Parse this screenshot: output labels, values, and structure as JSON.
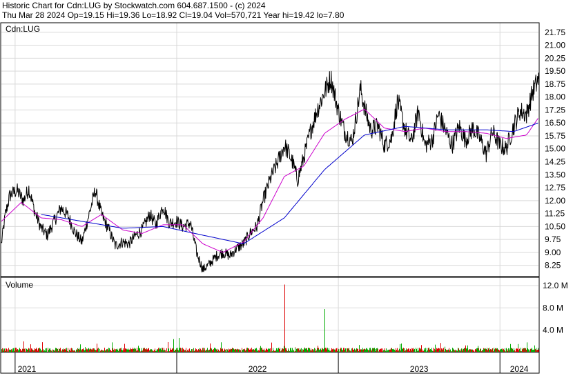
{
  "header": {
    "line1": "Historic Chart for Cdn:LUG by Stockwatch.com 604.687.1500 - (c) 2024",
    "line2": "Thu Mar 28 2024   Op=19.15  Hi=19.36  Lo=18.92  Cl=19.04  Vol=570,721  Year hi=19.42  lo=7.80"
  },
  "colors": {
    "price": "#000000",
    "ma_short": "#cc00cc",
    "ma_long": "#0000cc",
    "vol_up": "#00aa00",
    "vol_down": "#dd0000",
    "grid": "#d9d9d9"
  },
  "chart_data": [
    {
      "type": "line",
      "title": "Cdn:LUG",
      "y_axis_side": "right",
      "ylim": [
        7.6,
        22.3
      ],
      "y_ticks": [
        "21.75",
        "21.00",
        "20.25",
        "19.50",
        "18.75",
        "18.00",
        "17.25",
        "16.50",
        "15.75",
        "15.00",
        "14.25",
        "13.50",
        "12.75",
        "12.00",
        "11.25",
        "10.50",
        "9.75",
        "9.00",
        "8.25"
      ],
      "grid": true,
      "series": [
        {
          "key": "price",
          "x": [
            "2020-12-01",
            "2020-12-10",
            "2020-12-20",
            "2021-01-05",
            "2021-01-20",
            "2021-02-01",
            "2021-02-15",
            "2021-03-01",
            "2021-03-15",
            "2021-04-01",
            "2021-04-15",
            "2021-05-01",
            "2021-05-15",
            "2021-06-01",
            "2021-06-15",
            "2021-07-01",
            "2021-07-15",
            "2021-08-01",
            "2021-08-15",
            "2021-09-01",
            "2021-09-15",
            "2021-10-01",
            "2021-10-15",
            "2021-11-01",
            "2021-11-15",
            "2021-12-01",
            "2021-12-15",
            "2022-01-01",
            "2022-01-15",
            "2022-02-01",
            "2022-02-15",
            "2022-03-01",
            "2022-03-15",
            "2022-04-01",
            "2022-04-15",
            "2022-05-01",
            "2022-05-15",
            "2022-06-01",
            "2022-06-15",
            "2022-07-01",
            "2022-07-15",
            "2022-08-01",
            "2022-08-15",
            "2022-09-01",
            "2022-09-10",
            "2022-09-20",
            "2022-10-01",
            "2022-10-15",
            "2022-11-01",
            "2022-11-15",
            "2022-12-01",
            "2022-12-15",
            "2023-01-01",
            "2023-01-15",
            "2023-02-01",
            "2023-02-10",
            "2023-02-20",
            "2023-03-01",
            "2023-03-15",
            "2023-04-01",
            "2023-04-15",
            "2023-05-01",
            "2023-05-15",
            "2023-06-01",
            "2023-06-15",
            "2023-07-01",
            "2023-07-15",
            "2023-08-01",
            "2023-08-15",
            "2023-09-01",
            "2023-09-15",
            "2023-10-01",
            "2023-10-15",
            "2023-11-01",
            "2023-11-15",
            "2023-12-01",
            "2023-12-15",
            "2024-01-01",
            "2024-01-15",
            "2024-02-01",
            "2024-02-15",
            "2024-03-01",
            "2024-03-15",
            "2024-03-28"
          ],
          "values": [
            9.5,
            11.2,
            12.3,
            12.6,
            12.0,
            12.7,
            11.3,
            10.4,
            10.0,
            10.9,
            11.6,
            11.1,
            10.2,
            9.6,
            11.0,
            12.6,
            11.2,
            10.3,
            9.4,
            9.6,
            9.5,
            10.0,
            10.3,
            11.2,
            10.6,
            11.7,
            10.7,
            10.8,
            10.5,
            10.7,
            9.0,
            8.0,
            8.3,
            8.8,
            9.0,
            8.8,
            9.2,
            9.5,
            10.1,
            10.5,
            12.0,
            13.3,
            14.1,
            15.2,
            14.8,
            14.2,
            13.2,
            14.5,
            16.2,
            17.3,
            18.3,
            19.1,
            17.2,
            16.0,
            15.4,
            16.8,
            18.5,
            17.4,
            16.1,
            16.3,
            15.2,
            15.6,
            17.8,
            16.1,
            15.4,
            17.2,
            15.2,
            15.5,
            17.0,
            16.0,
            15.2,
            16.3,
            15.5,
            16.2,
            15.7,
            14.7,
            16.0,
            15.2,
            15.0,
            16.3,
            17.2,
            17.0,
            18.3,
            19.04
          ]
        },
        {
          "key": "ma_short",
          "x": [
            "2020-12-01",
            "2021-01-15",
            "2021-03-01",
            "2021-04-15",
            "2021-06-01",
            "2021-07-15",
            "2021-09-01",
            "2021-10-15",
            "2021-12-01",
            "2022-01-15",
            "2022-03-01",
            "2022-04-15",
            "2022-06-01",
            "2022-07-15",
            "2022-09-01",
            "2022-10-15",
            "2022-12-01",
            "2023-01-15",
            "2023-03-01",
            "2023-04-15",
            "2023-06-01",
            "2023-07-15",
            "2023-09-01",
            "2023-10-15",
            "2023-12-01",
            "2024-01-15",
            "2024-03-01",
            "2024-03-28"
          ],
          "values": [
            10.8,
            11.9,
            11.0,
            10.9,
            10.5,
            11.2,
            10.3,
            10.1,
            10.6,
            10.6,
            9.5,
            9.0,
            9.6,
            11.0,
            13.4,
            14.0,
            15.9,
            16.7,
            17.3,
            16.2,
            16.0,
            16.2,
            16.0,
            16.0,
            15.9,
            15.6,
            15.8,
            16.8
          ]
        },
        {
          "key": "ma_long",
          "x": [
            "2021-03-01",
            "2021-06-01",
            "2021-09-01",
            "2021-12-01",
            "2022-03-01",
            "2022-06-01",
            "2022-09-01",
            "2022-12-01",
            "2023-03-01",
            "2023-06-01",
            "2023-09-01",
            "2023-12-01",
            "2024-02-01",
            "2024-03-28"
          ],
          "values": [
            11.2,
            10.8,
            10.4,
            10.5,
            10.0,
            9.5,
            11.0,
            13.8,
            15.8,
            16.3,
            16.1,
            16.1,
            16.0,
            16.5
          ]
        }
      ]
    },
    {
      "type": "bar",
      "title": "Volume",
      "y_axis_side": "right",
      "ylim": [
        0,
        13.5
      ],
      "y_ticks": [
        "12.0 M",
        "8.0 M",
        "4.0 M"
      ],
      "grid": true,
      "spikes": [
        {
          "date": "2021-01-20",
          "value": 2.0,
          "dir": "down"
        },
        {
          "date": "2021-12-25",
          "value": 2.4,
          "dir": "up"
        },
        {
          "date": "2022-01-05",
          "value": 2.6,
          "dir": "up"
        },
        {
          "date": "2022-09-01",
          "value": 12.2,
          "dir": "down"
        },
        {
          "date": "2022-12-01",
          "value": 7.8,
          "dir": "up"
        },
        {
          "date": "2022-11-15",
          "value": 1.2,
          "dir": "down"
        }
      ],
      "baseline_level": 0.5
    }
  ],
  "x_axis": {
    "labels": [
      "2021",
      "2022",
      "2023",
      "2024"
    ],
    "year_starts": [
      "2021-01-01",
      "2022-01-01",
      "2023-01-01",
      "2024-01-01"
    ],
    "domain": [
      "2020-12-01",
      "2024-03-28"
    ]
  }
}
